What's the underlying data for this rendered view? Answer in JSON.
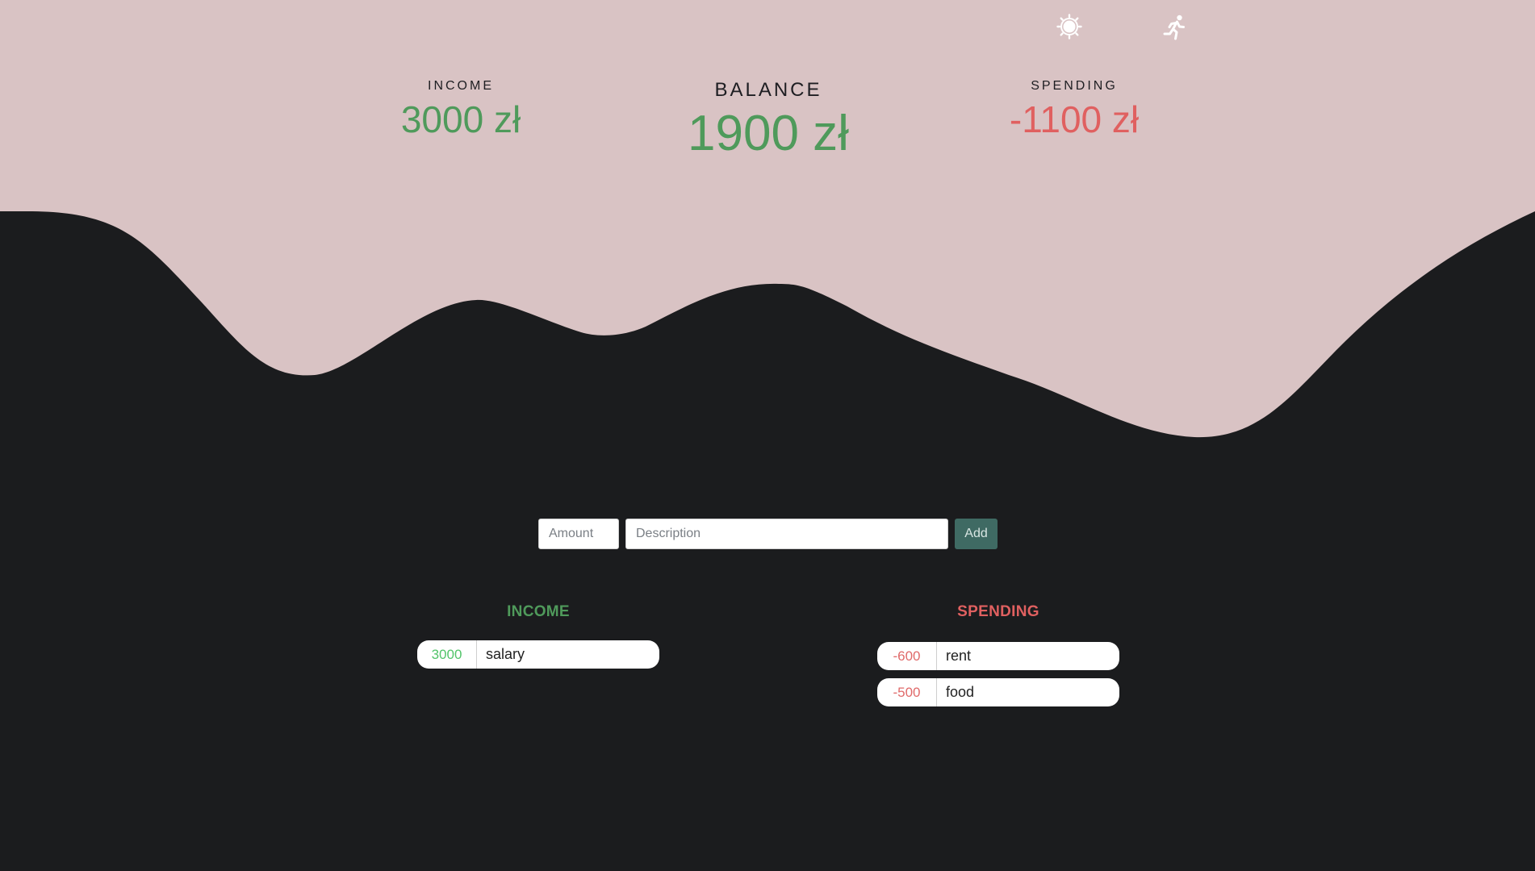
{
  "theme_colors": {
    "hero_background": "#d9c3c4",
    "page_background": "#1b1c1e",
    "positive": "#4f9a5b",
    "negative": "#e06060",
    "add_button": "#3f6a63"
  },
  "header": {
    "theme_toggle_icon": "sun-icon",
    "logout_icon": "running-person-icon"
  },
  "summary": {
    "income_label": "INCOME",
    "income_value": "3000 zł",
    "balance_label": "BALANCE",
    "balance_value": "1900 zł",
    "spending_label": "SPENDING",
    "spending_value": "-1100 zł"
  },
  "form": {
    "amount_placeholder": "Amount",
    "amount_value": "",
    "description_placeholder": "Description",
    "description_value": "",
    "add_label": "Add"
  },
  "lists": {
    "income": {
      "heading": "INCOME",
      "items": [
        {
          "amount": "3000",
          "description": "salary"
        }
      ]
    },
    "spending": {
      "heading": "SPENDING",
      "items": [
        {
          "amount": "-600",
          "description": "rent"
        },
        {
          "amount": "-500",
          "description": "food"
        }
      ]
    }
  }
}
